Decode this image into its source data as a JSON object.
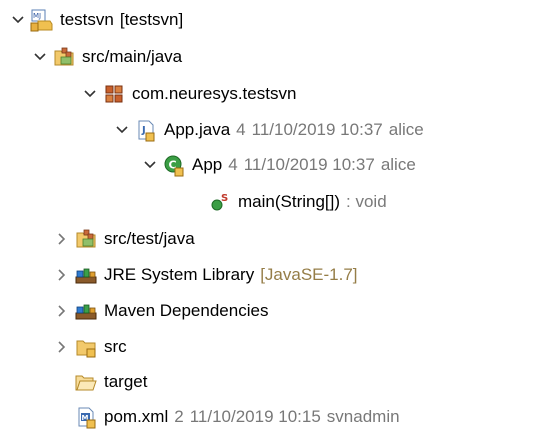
{
  "tree": {
    "project": {
      "name": "testsvn",
      "repo": "[testsvn]"
    },
    "src_main": {
      "label": "src/main/java"
    },
    "package": {
      "label": "com.neuresys.testsvn"
    },
    "app_java": {
      "label": "App.java",
      "rev": "4",
      "date": "11/10/2019 10:37",
      "author": "alice"
    },
    "app_class": {
      "label": "App",
      "rev": "4",
      "date": "11/10/2019 10:37",
      "author": "alice"
    },
    "main_method": {
      "label": "main(String[])",
      "type": ": void"
    },
    "src_test": {
      "label": "src/test/java"
    },
    "jre": {
      "label": "JRE System Library",
      "version": "[JavaSE-1.7]"
    },
    "maven": {
      "label": "Maven Dependencies"
    },
    "src": {
      "label": "src"
    },
    "target": {
      "label": "target"
    },
    "pom": {
      "label": "pom.xml",
      "rev": "2",
      "date": "11/10/2019 10:15",
      "author": "svnadmin"
    }
  },
  "icons": {
    "project": "java-project-svn-icon",
    "source_folder": "source-folder-icon",
    "package": "package-icon",
    "java_file": "java-file-icon",
    "class": "class-icon",
    "method": "public-static-method-icon",
    "library": "library-icon",
    "folder": "folder-icon",
    "open_folder": "open-folder-icon",
    "xml_file": "maven-pom-icon"
  },
  "colors": {
    "decoration": "#787878",
    "library_version": "#957d47",
    "class_green": "#3b9e45",
    "package_brown": "#a0522d"
  }
}
